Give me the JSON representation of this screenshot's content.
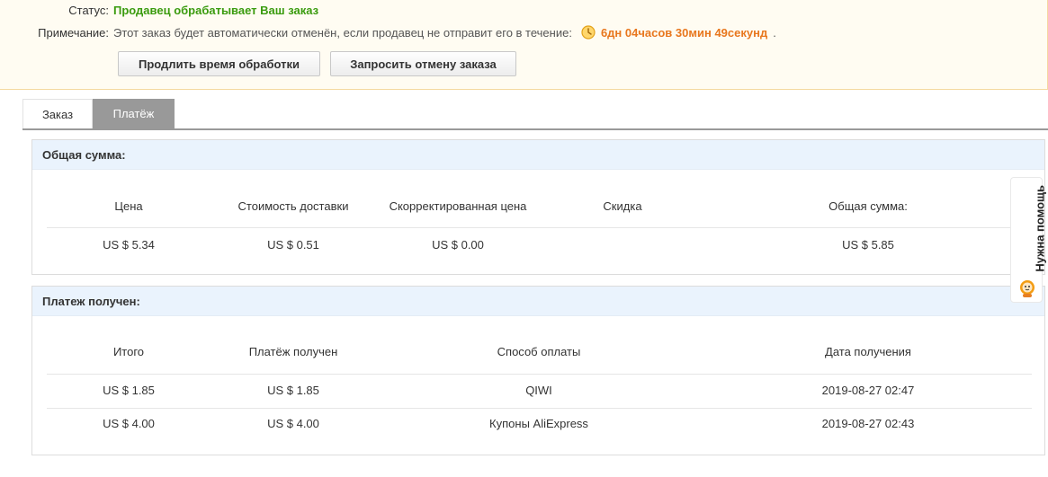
{
  "status": {
    "status_label": "Статус:",
    "status_value": "Продавец обрабатывает Ваш заказ",
    "note_label": "Примечание:",
    "note_text": "Этот заказ будет автоматически отменён, если продавец не отправит его в течение:",
    "countdown": "6дн 04часов 30мин 49секунд",
    "note_end": "."
  },
  "buttons": {
    "extend": "Продлить время обработки",
    "cancel": "Запросить отмену заказа"
  },
  "tabs": [
    {
      "label": "Заказ",
      "active": false
    },
    {
      "label": "Платёж",
      "active": true
    }
  ],
  "total": {
    "heading": "Общая сумма:",
    "columns": [
      "Цена",
      "Стоимость доставки",
      "Скорректированная цена",
      "Скидка",
      "Общая сумма:"
    ],
    "values": [
      "US $ 5.34",
      "US $ 0.51",
      "US $ 0.00",
      "",
      "US $ 5.85"
    ]
  },
  "payment": {
    "heading": "Платеж получен:",
    "columns": [
      "Итого",
      "Платёж получен",
      "Способ оплаты",
      "Дата получения"
    ],
    "rows": [
      [
        "US $ 1.85",
        "US $ 1.85",
        "QIWI",
        "2019-08-27 02:47"
      ],
      [
        "US $ 4.00",
        "US $ 4.00",
        "Купоны AliExpress",
        "2019-08-27 02:43"
      ]
    ]
  },
  "help": {
    "label": "Нужна помощь"
  },
  "colors": {
    "status": "#3a9b0e",
    "countdown": "#e8771e",
    "panel_header": "#eaf3fd",
    "active_tab": "#999999"
  },
  "icons": {
    "clock": "clock-icon",
    "mascot": "mascot-icon"
  }
}
